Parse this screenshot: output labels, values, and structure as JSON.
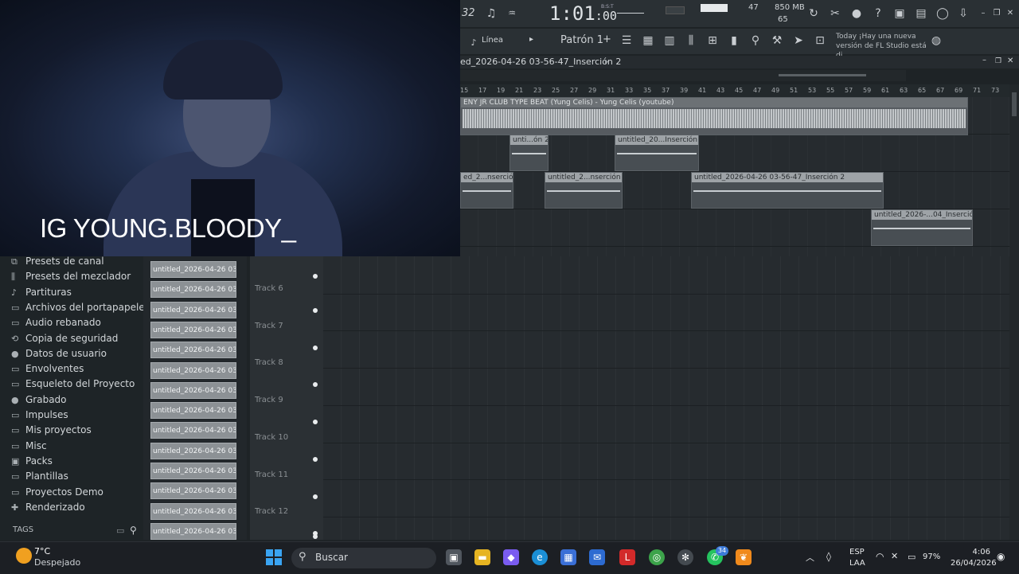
{
  "webcam": {
    "caption": "IG YOUNG.BLOODY_"
  },
  "toolbar": {
    "tempo_mode": "32",
    "time_main": "1:01",
    "time_sub": ":00",
    "time_unit": "B:S:T",
    "cpu": "47",
    "mem_mb": "850 MB",
    "mem_poly": "65",
    "snap_label": "Línea",
    "pattern": "Patrón 1",
    "news_label": "Today",
    "news_text": "¡Hay una nueva versión de FL Studio está di…"
  },
  "playlist": {
    "title": "ed_2026-04-26 03-56-47_Inserción 2",
    "ruler": [
      "15",
      "17",
      "19",
      "21",
      "23",
      "25",
      "27",
      "29",
      "31",
      "33",
      "35",
      "37",
      "39",
      "41",
      "43",
      "45",
      "47",
      "49",
      "51",
      "53",
      "55",
      "57",
      "59",
      "61",
      "63",
      "65",
      "67",
      "69",
      "71",
      "73"
    ],
    "main_clip": "ENY JR CLUB TYPE BEAT (Yung Celis) - Yung Celis (youtube)",
    "clips": [
      {
        "label": "unti...ón 2"
      },
      {
        "label": "untitled_20...Inserción 2"
      },
      {
        "label": "ed_2...nserción 2"
      },
      {
        "label": "untitled_2...nserción 2"
      },
      {
        "label": "untitled_2026-04-26 03-56-47_Inserción 2"
      },
      {
        "label": "untitled_2026-...04_Inserción 2"
      }
    ],
    "tracks": [
      "Track 6",
      "Track 7",
      "Track 8",
      "Track 9",
      "Track 10",
      "Track 11",
      "Track 12"
    ]
  },
  "browser": {
    "items": [
      {
        "label": "Presets de canal",
        "icon": "plugin-icon"
      },
      {
        "label": "Presets del mezclador",
        "icon": "mixer-icon"
      },
      {
        "label": "Partituras",
        "icon": "note-icon"
      },
      {
        "label": "Archivos del portapapeles",
        "icon": "folder-icon"
      },
      {
        "label": "Audio rebanado",
        "icon": "folder-icon"
      },
      {
        "label": "Copia de seguridad",
        "icon": "backup-icon"
      },
      {
        "label": "Datos de usuario",
        "icon": "user-icon"
      },
      {
        "label": "Envolventes",
        "icon": "folder-icon"
      },
      {
        "label": "Esqueleto del Proyecto",
        "icon": "folder-icon"
      },
      {
        "label": "Grabado",
        "icon": "mic-icon"
      },
      {
        "label": "Impulses",
        "icon": "folder-icon"
      },
      {
        "label": "Mis proyectos",
        "icon": "folder-icon"
      },
      {
        "label": "Misc",
        "icon": "folder-icon"
      },
      {
        "label": "Packs",
        "icon": "pack-icon"
      },
      {
        "label": "Plantillas",
        "icon": "folder-icon"
      },
      {
        "label": "Proyectos Demo",
        "icon": "folder-icon"
      },
      {
        "label": "Renderizado",
        "icon": "render-icon"
      }
    ],
    "tags": "TAGS"
  },
  "rack": {
    "channels": [
      "untitled_2026-04-26 03-…",
      "untitled_2026-04-26 03-…",
      "untitled_2026-04-26 03-…",
      "untitled_2026-04-26 03-…",
      "untitled_2026-04-26 03-…",
      "untitled_2026-04-26 03-…",
      "untitled_2026-04-26 03-…",
      "untitled_2026-04-26 03-…",
      "untitled_2026-04-26 03-…",
      "untitled_2026-04-26 03-…",
      "untitled_2026-04-26 03-…",
      "untitled_2026-04-26 03-…",
      "untitled_2026-04-26 03-…",
      "untitled_2026-04-26 03-…"
    ]
  },
  "taskbar": {
    "temp": "7°C",
    "sky": "Despejado",
    "search_placeholder": "Buscar",
    "lang1": "ESP",
    "lang2": "LAA",
    "battery": "97%",
    "time": "4:06",
    "date": "26/04/2026",
    "whatsapp_badge": "34"
  }
}
